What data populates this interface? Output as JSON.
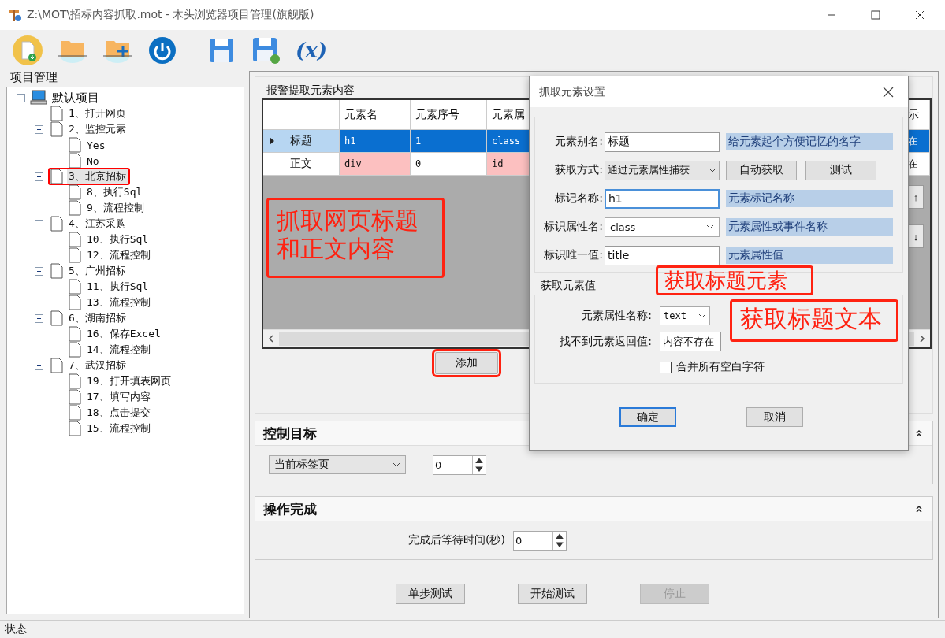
{
  "window": {
    "title": "Z:\\MOT\\招标内容抓取.mot  - 木头浏览器项目管理(旗舰版)"
  },
  "toolbar": [
    {
      "kind": "new-file"
    },
    {
      "kind": "open-folder"
    },
    {
      "kind": "add-folder"
    },
    {
      "kind": "power"
    },
    {
      "kind": "separator"
    },
    {
      "kind": "save"
    },
    {
      "kind": "save-as"
    },
    {
      "kind": "variable",
      "label": "(x)"
    }
  ],
  "project_panel": {
    "title": "项目管理",
    "tree": [
      {
        "label": "默认项目",
        "expanded": true,
        "selected": false,
        "children": [
          {
            "label": "1、打开网页",
            "selected": false,
            "annotated": false
          },
          {
            "label": "2、监控元素",
            "expanded": true,
            "selected": false,
            "annotated": false,
            "children": [
              {
                "label": "Yes",
                "selected": false
              },
              {
                "label": "No",
                "selected": false
              }
            ]
          },
          {
            "label": "3、北京招标",
            "expanded": true,
            "selected": true,
            "annotated": true,
            "children": [
              {
                "label": "8、执行Sql",
                "selected": false
              },
              {
                "label": "9、流程控制",
                "selected": false
              }
            ]
          },
          {
            "label": "4、江苏采购",
            "expanded": true,
            "selected": false,
            "annotated": false,
            "children": [
              {
                "label": "10、执行Sql",
                "selected": false
              },
              {
                "label": "12、流程控制",
                "selected": false
              }
            ]
          },
          {
            "label": "5、广州招标",
            "expanded": true,
            "selected": false,
            "annotated": false,
            "children": [
              {
                "label": "11、执行Sql",
                "selected": false
              },
              {
                "label": "13、流程控制",
                "selected": false
              }
            ]
          },
          {
            "label": "6、湖南招标",
            "expanded": true,
            "selected": false,
            "annotated": false,
            "children": [
              {
                "label": "16、保存Excel",
                "selected": false
              },
              {
                "label": "14、流程控制",
                "selected": false
              }
            ]
          },
          {
            "label": "7、武汉招标",
            "expanded": true,
            "selected": false,
            "annotated": false,
            "children": [
              {
                "label": "19、打开填表网页",
                "selected": false
              },
              {
                "label": "17、填写内容",
                "selected": false
              },
              {
                "label": "18、点击提交",
                "selected": false
              },
              {
                "label": "15、流程控制",
                "selected": false
              }
            ]
          }
        ]
      }
    ]
  },
  "grid": {
    "title": "报警提取元素内容",
    "columns": [
      "元素名",
      "元素序号",
      "元素属",
      "示"
    ],
    "rows": [
      {
        "name": "标题",
        "selected": true,
        "cells": [
          {
            "text": "h1",
            "flagged": false
          },
          {
            "text": "1",
            "flagged": false
          },
          {
            "text": "class",
            "flagged": false
          },
          {
            "text": "在",
            "flagged": false
          }
        ]
      },
      {
        "name": "正文",
        "selected": false,
        "cells": [
          {
            "text": "div",
            "flagged": true
          },
          {
            "text": "0",
            "flagged": false
          },
          {
            "text": "id",
            "flagged": true
          },
          {
            "text": "在",
            "flagged": false
          }
        ]
      }
    ],
    "move_buttons": [
      "↑",
      "↓"
    ],
    "note": "抓取网页标题和正文内容"
  },
  "add_button": {
    "label": "添加",
    "annotated": true
  },
  "dialog": {
    "title": "抓取元素设置",
    "fields": [
      {
        "kind": "input",
        "label": "元素别名:",
        "value": "标题",
        "hint": "给元素起个方便记忆的名字",
        "focused": false
      },
      {
        "kind": "select",
        "label": "获取方式:",
        "value": "通过元素属性捕获",
        "buttons": [
          "自动获取",
          "测试"
        ]
      },
      {
        "kind": "input",
        "label": "标记名称:",
        "value": "h1",
        "hint": "元素标记名称",
        "focused": true
      },
      {
        "kind": "select",
        "label": "标识属性名:",
        "value": "class",
        "hint": "元素属性或事件名称"
      },
      {
        "kind": "input",
        "label": "标识唯一值:",
        "value": "title",
        "hint": "元素属性值",
        "focused": false
      }
    ],
    "value_group": {
      "title": "获取元素值",
      "attribute_label": "元素属性名称:",
      "attribute_value": "text",
      "fallback_label": "找不到元素返回值:",
      "fallback_value": "内容不存在",
      "merge_whitespace": {
        "label": "合并所有空白字符",
        "checked": false
      }
    },
    "buttons": [
      {
        "label": "确定",
        "default": true
      },
      {
        "label": "取消",
        "default": false
      }
    ],
    "notes": [
      "获取标题元素",
      "获取标题文本"
    ]
  },
  "control_target": {
    "title": "控制目标",
    "expanded": true,
    "tab": "当前标签页",
    "index": "0"
  },
  "completion": {
    "title": "操作完成",
    "expanded": true,
    "wait_label": "完成后等待时间(秒)",
    "wait": "0"
  },
  "actions": [
    {
      "label": "单步测试",
      "disabled": false
    },
    {
      "label": "开始测试",
      "disabled": false
    },
    {
      "label": "停止",
      "disabled": true
    }
  ],
  "status_bar": "状态"
}
